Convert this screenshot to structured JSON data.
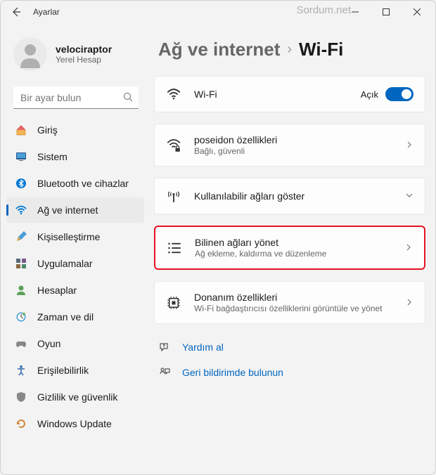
{
  "window": {
    "title": "Ayarlar",
    "watermark": "Sordum.net"
  },
  "user": {
    "name": "velociraptor",
    "subtitle": "Yerel Hesap"
  },
  "search": {
    "placeholder": "Bir ayar bulun"
  },
  "nav": {
    "items": [
      {
        "label": "Giriş",
        "icon": "home"
      },
      {
        "label": "Sistem",
        "icon": "system"
      },
      {
        "label": "Bluetooth ve cihazlar",
        "icon": "bluetooth"
      },
      {
        "label": "Ağ ve internet",
        "icon": "wifi"
      },
      {
        "label": "Kişiselleştirme",
        "icon": "paint"
      },
      {
        "label": "Uygulamalar",
        "icon": "apps"
      },
      {
        "label": "Hesaplar",
        "icon": "account"
      },
      {
        "label": "Zaman ve dil",
        "icon": "clock"
      },
      {
        "label": "Oyun",
        "icon": "game"
      },
      {
        "label": "Erişilebilirlik",
        "icon": "accessibility"
      },
      {
        "label": "Gizlilik ve güvenlik",
        "icon": "privacy"
      },
      {
        "label": "Windows Update",
        "icon": "update"
      }
    ],
    "activeIndex": 3
  },
  "breadcrumb": {
    "parent": "Ağ ve internet",
    "current": "Wi-Fi"
  },
  "cards": {
    "wifi": {
      "title": "Wi-Fi",
      "status": "Açık"
    },
    "props": {
      "title": "poseidon özellikleri",
      "sub": "Bağlı, güvenli"
    },
    "available": {
      "title": "Kullanılabilir ağları göster"
    },
    "known": {
      "title": "Bilinen ağları yönet",
      "sub": "Ağ ekleme, kaldırma ve düzenleme"
    },
    "hardware": {
      "title": "Donanım özellikleri",
      "sub": "Wi-Fi bağdaştırıcısı özelliklerini görüntüle ve yönet"
    }
  },
  "help": {
    "get": "Yardım al",
    "feedback": "Geri bildirimde bulunun"
  }
}
